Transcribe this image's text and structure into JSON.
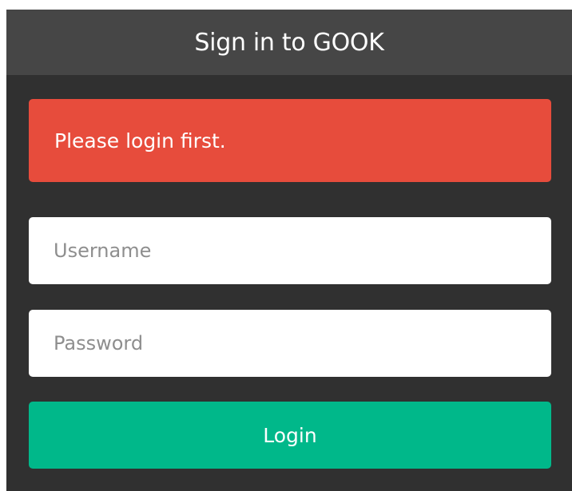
{
  "header": {
    "title": "Sign in to GOOK"
  },
  "alert": {
    "message": "Please login first."
  },
  "form": {
    "username_placeholder": "Username",
    "username_value": "",
    "password_placeholder": "Password",
    "password_value": "",
    "login_label": "Login"
  },
  "colors": {
    "panel_background": "#303030",
    "header_background": "#464646",
    "alert_background": "#e74c3c",
    "button_background": "#00b88a",
    "input_background": "#ffffff"
  }
}
